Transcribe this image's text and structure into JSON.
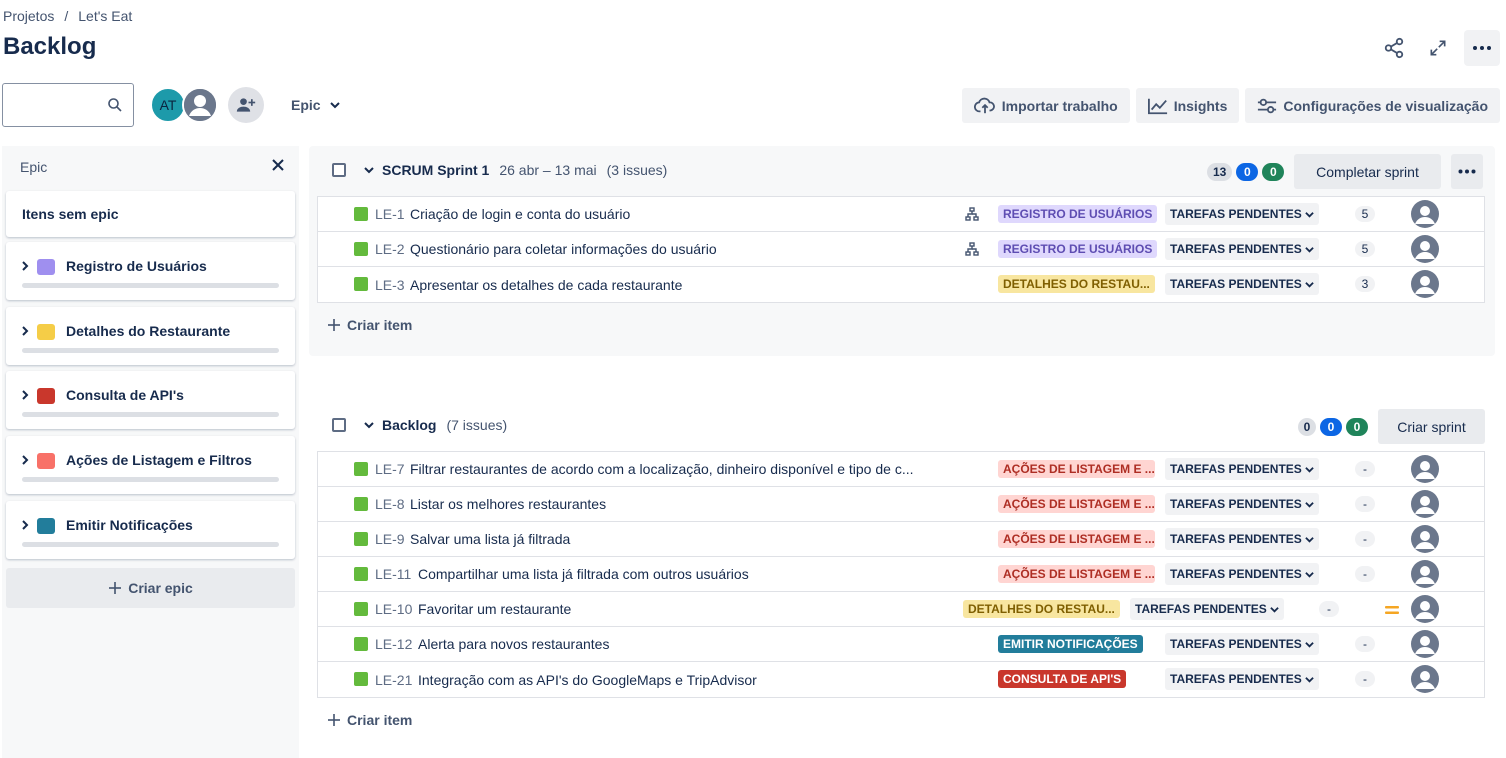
{
  "breadcrumb": {
    "projects": "Projetos",
    "separator": "/",
    "project": "Let's Eat"
  },
  "page_title": "Backlog",
  "avatar_initials": "AT",
  "epic_filter_label": "Epic",
  "toolbar": {
    "import_label": "Importar trabalho",
    "insights_label": "Insights",
    "view_settings_label": "Configurações de visualização"
  },
  "epic_panel": {
    "title": "Epic",
    "no_epic_label": "Itens sem epic",
    "create_epic_label": "Criar epic",
    "epics": [
      {
        "name": "Registro de Usuários",
        "color": "#9f8fef"
      },
      {
        "name": "Detalhes do Restaurante",
        "color": "#f5cd47"
      },
      {
        "name": "Consulta de API's",
        "color": "#c9372c"
      },
      {
        "name": "Ações de Listagem e Filtros",
        "color": "#f87168"
      },
      {
        "name": "Emitir Notificações",
        "color": "#227d9b"
      }
    ]
  },
  "sprint": {
    "name": "SCRUM Sprint 1",
    "dates": "26 abr – 13 mai",
    "issue_count": "(3 issues)",
    "counters": [
      "13",
      "0",
      "0"
    ],
    "complete_label": "Completar sprint",
    "create_item_label": "Criar item",
    "issues": [
      {
        "key": "LE-1",
        "summary": "Criação de login e conta do usuário",
        "epic": "REGISTRO DE USUÁRIOS",
        "status": "TAREFAS PENDENTES",
        "estimate": "5"
      },
      {
        "key": "LE-2",
        "summary": "Questionário para coletar informações do usuário",
        "epic": "REGISTRO DE USUÁRIOS",
        "status": "TAREFAS PENDENTES",
        "estimate": "5"
      },
      {
        "key": "LE-3",
        "summary": "Apresentar os detalhes de cada restaurante",
        "epic": "DETALHES DO RESTAU...",
        "status": "TAREFAS PENDENTES",
        "estimate": "3"
      }
    ]
  },
  "backlog": {
    "name": "Backlog",
    "issue_count": "(7 issues)",
    "counters": [
      "0",
      "0",
      "0"
    ],
    "create_sprint_label": "Criar sprint",
    "create_item_label": "Criar item",
    "issues": [
      {
        "key": "LE-7",
        "summary": "Filtrar restaurantes de acordo com a localização, dinheiro disponível e tipo de c...",
        "epic": "AÇÕES DE LISTAGEM E ...",
        "status": "TAREFAS PENDENTES",
        "estimate": "-"
      },
      {
        "key": "LE-8",
        "summary": "Listar os melhores restaurantes",
        "epic": "AÇÕES DE LISTAGEM E ...",
        "status": "TAREFAS PENDENTES",
        "estimate": "-"
      },
      {
        "key": "LE-9",
        "summary": "Salvar uma lista já filtrada",
        "epic": "AÇÕES DE LISTAGEM E ...",
        "status": "TAREFAS PENDENTES",
        "estimate": "-"
      },
      {
        "key": "LE-11",
        "summary": "Compartilhar uma lista já filtrada com outros usuários",
        "epic": "AÇÕES DE LISTAGEM E ...",
        "status": "TAREFAS PENDENTES",
        "estimate": "-"
      },
      {
        "key": "LE-10",
        "summary": "Favoritar um restaurante",
        "epic": "DETALHES DO RESTAU...",
        "status": "TAREFAS PENDENTES",
        "estimate": "-"
      },
      {
        "key": "LE-12",
        "summary": "Alerta para novos restaurantes",
        "epic": "EMITIR NOTIFICAÇÕES",
        "status": "TAREFAS PENDENTES",
        "estimate": "-"
      },
      {
        "key": "LE-21",
        "summary": "Integração com as API's do GoogleMaps e TripAdvisor",
        "epic": "CONSULTA DE API'S",
        "status": "TAREFAS PENDENTES",
        "estimate": "-"
      }
    ]
  }
}
